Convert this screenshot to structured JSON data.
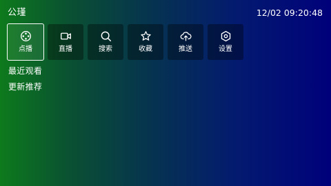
{
  "app": {
    "title": "公瑾"
  },
  "status": {
    "datetime": "12/02 09:20:48"
  },
  "nav": {
    "items": [
      {
        "label": "点播",
        "icon": "film-reel-icon",
        "selected": true
      },
      {
        "label": "直播",
        "icon": "video-camera-icon",
        "selected": false
      },
      {
        "label": "搜索",
        "icon": "search-icon",
        "selected": false
      },
      {
        "label": "收藏",
        "icon": "star-icon",
        "selected": false
      },
      {
        "label": "推送",
        "icon": "cloud-upload-icon",
        "selected": false
      },
      {
        "label": "设置",
        "icon": "gear-icon",
        "selected": false
      }
    ]
  },
  "sections": {
    "recent": "最近观看",
    "recommend": "更新推荐"
  },
  "colors": {
    "background_left": "#0d7a1c",
    "background_right": "#00007a",
    "tile_background": "#000000",
    "selected_border": "#ffffff"
  }
}
